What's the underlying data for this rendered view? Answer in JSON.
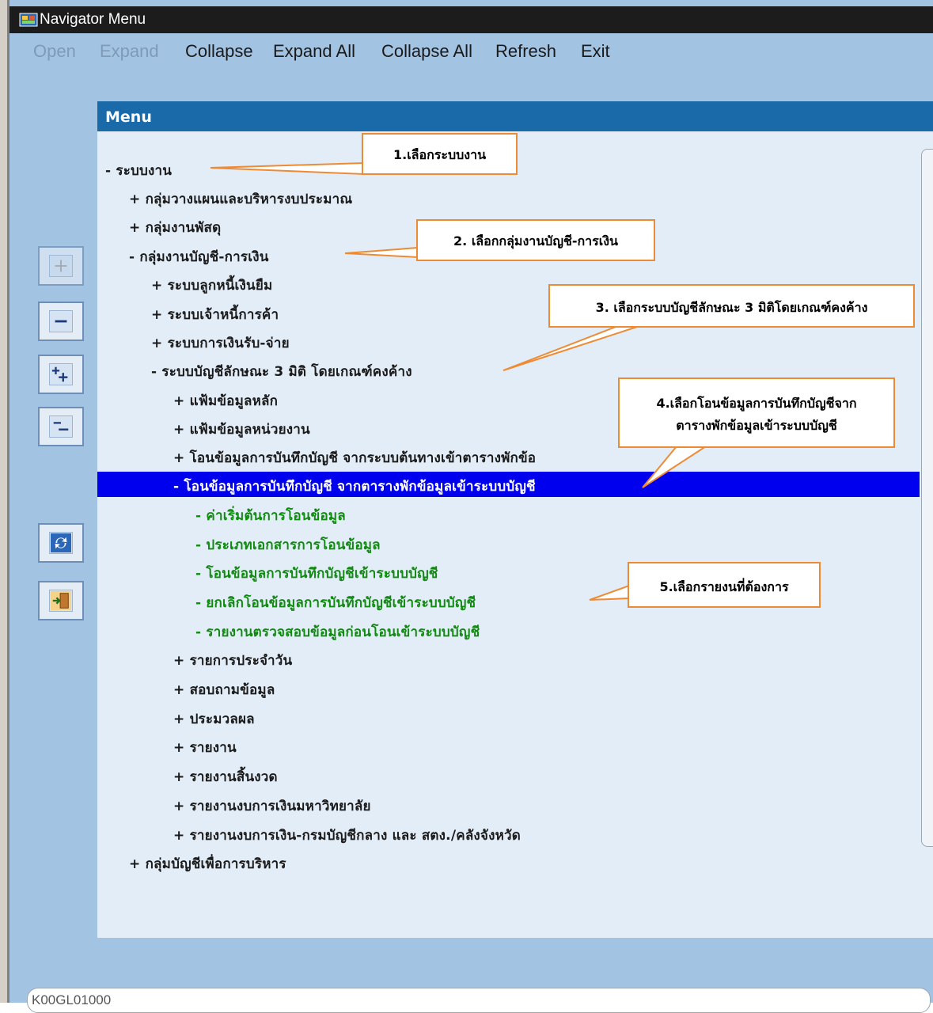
{
  "window": {
    "title": "Navigator Menu"
  },
  "menubar": {
    "items": [
      {
        "label": "Open",
        "enabled": false
      },
      {
        "label": "Expand",
        "enabled": false
      },
      {
        "label": "Collapse",
        "enabled": true
      },
      {
        "label": "Expand All",
        "enabled": true
      },
      {
        "label": "Collapse All",
        "enabled": true
      },
      {
        "label": "Refresh",
        "enabled": true
      },
      {
        "label": "Exit",
        "enabled": true
      }
    ]
  },
  "menu_panel": {
    "header": "Menu",
    "tree": [
      {
        "label": "- ระบบงาน"
      },
      {
        "label": "+ กลุ่มวางแผนและบริหารงบประมาณ"
      },
      {
        "label": "+ กลุ่มงานพัสดุ"
      },
      {
        "label": "- กลุ่มงานบัญชี-การเงิน"
      },
      {
        "label": "+ ระบบลูกหนี้เงินยืม"
      },
      {
        "label": "+ ระบบเจ้าหนี้การค้า"
      },
      {
        "label": "+ ระบบการเงินรับ-จ่าย"
      },
      {
        "label": "- ระบบบัญชีลักษณะ 3 มิติ โดยเกณฑ์คงค้าง"
      },
      {
        "label": "+ แฟ้มข้อมูลหลัก"
      },
      {
        "label": "+ แฟ้มข้อมูลหน่วยงาน"
      },
      {
        "label": "+ โอนข้อมูลการบันทึกบัญชี จากระบบต้นทางเข้าตารางพักข้อ"
      },
      {
        "label": "- โอนข้อมูลการบันทึกบัญชี จากตารางพักข้อมูลเข้าระบบบัญชี",
        "selected": true
      },
      {
        "label": "- ค่าเริ่มต้นการโอนข้อมูล"
      },
      {
        "label": "- ประเภทเอกสารการโอนข้อมูล"
      },
      {
        "label": "- โอนข้อมูลการบันทึกบัญชีเข้าระบบบัญชี"
      },
      {
        "label": "- ยกเลิกโอนข้อมูลการบันทึกบัญชีเข้าระบบบัญชี"
      },
      {
        "label": "- รายงานตรวจสอบข้อมูลก่อนโอนเข้าระบบบัญชี"
      },
      {
        "label": "+ รายการประจำวัน"
      },
      {
        "label": "+ สอบถามข้อมูล"
      },
      {
        "label": "+ ประมวลผล"
      },
      {
        "label": "+ รายงาน"
      },
      {
        "label": "+ รายงานสิ้นงวด"
      },
      {
        "label": "+ รายงานงบการเงินมหาวิทยาลัย"
      },
      {
        "label": "+ รายงานงบการเงิน-กรมบัญชีกลาง และ สตง./คลังจังหวัด"
      },
      {
        "label": "+ กลุ่มบัญชีเพื่อการบริหาร"
      }
    ]
  },
  "callouts": [
    {
      "lines": [
        "1.เลือกระบบงาน"
      ]
    },
    {
      "lines": [
        "2. เลือกกลุ่มงานบัญชี-การเงิน"
      ]
    },
    {
      "lines": [
        "3. เลือกระบบบัญชีลักษณะ 3 มิติโดยเกณฑ์คงค้าง"
      ]
    },
    {
      "lines": [
        "4.เลือกโอนข้อมูลการบันทึกบัญชีจาก",
        "ตารางพักข้อมูลเข้าระบบบัญชี"
      ]
    },
    {
      "lines": [
        "5.เลือกรายงนที่ต้องการ"
      ]
    }
  ],
  "side_toolbar": [
    {
      "icon": "expand-plus-icon"
    },
    {
      "icon": "collapse-minus-icon"
    },
    {
      "icon": "expand-all-icon"
    },
    {
      "icon": "collapse-all-icon"
    },
    {
      "icon": "refresh-icon"
    },
    {
      "icon": "exit-door-icon"
    }
  ],
  "statusbar": {
    "code": "K00GL01000"
  },
  "colors": {
    "window_bg": "#a3c3e3",
    "panel_bg": "#e3edf8",
    "header_bg": "#1a6aaa",
    "selected_bg": "#0000ee",
    "green_text": "#108a10",
    "callout_border": "#ed8b35"
  }
}
